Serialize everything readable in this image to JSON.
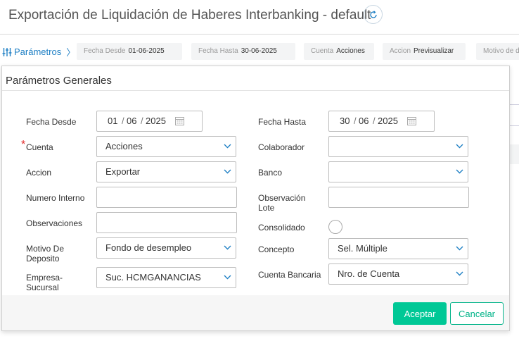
{
  "header": {
    "title": "Exportación de Liquidación de Haberes Interbanking - default"
  },
  "params_bar": {
    "link_label": "Parámetros",
    "chips": [
      {
        "label": "Fecha Desde",
        "value": "01-06-2025"
      },
      {
        "label": "Fecha Hasta",
        "value": "30-06-2025"
      },
      {
        "label": "Cuenta",
        "value": "Acciones"
      },
      {
        "label": "Accion",
        "value": "Previsualizar"
      },
      {
        "label": "Motivo de d",
        "value": ""
      }
    ]
  },
  "dialog": {
    "title": "Parámetros Generales",
    "fields": {
      "fecha_desde": {
        "label": "Fecha Desde",
        "day": "01",
        "month": "06",
        "year": "2025",
        "sep": "/"
      },
      "fecha_hasta": {
        "label": "Fecha Hasta",
        "day": "30",
        "month": "06",
        "year": "2025",
        "sep": "/"
      },
      "cuenta": {
        "label": "Cuenta",
        "value": "Acciones",
        "required_mark": "*"
      },
      "colaborador": {
        "label": "Colaborador",
        "value": ""
      },
      "accion": {
        "label": "Accion",
        "value": "Exportar"
      },
      "banco": {
        "label": "Banco",
        "value": ""
      },
      "numero_interno": {
        "label": "Numero Interno",
        "value": ""
      },
      "observacion_lote": {
        "label_1": "Observación",
        "label_2": "Lote",
        "value": ""
      },
      "observaciones": {
        "label": "Observaciones",
        "value": ""
      },
      "consolidado": {
        "label": "Consolidado"
      },
      "motivo_deposito": {
        "label_1": "Motivo De",
        "label_2": "Deposito",
        "value": "Fondo de desempleo"
      },
      "concepto": {
        "label": "Concepto",
        "value": "Sel. Múltiple"
      },
      "empresa_sucursal": {
        "label_1": "Empresa-",
        "label_2": "Sucursal",
        "value": "Suc. HCMGANANCIAS"
      },
      "cuenta_bancaria": {
        "label": "Cuenta Bancaria",
        "value": "Nro. de Cuenta"
      }
    },
    "buttons": {
      "accept": "Aceptar",
      "cancel": "Cancelar"
    }
  },
  "colors": {
    "accent": "#00c896",
    "link": "#1e7fc4",
    "required": "#e02424"
  }
}
